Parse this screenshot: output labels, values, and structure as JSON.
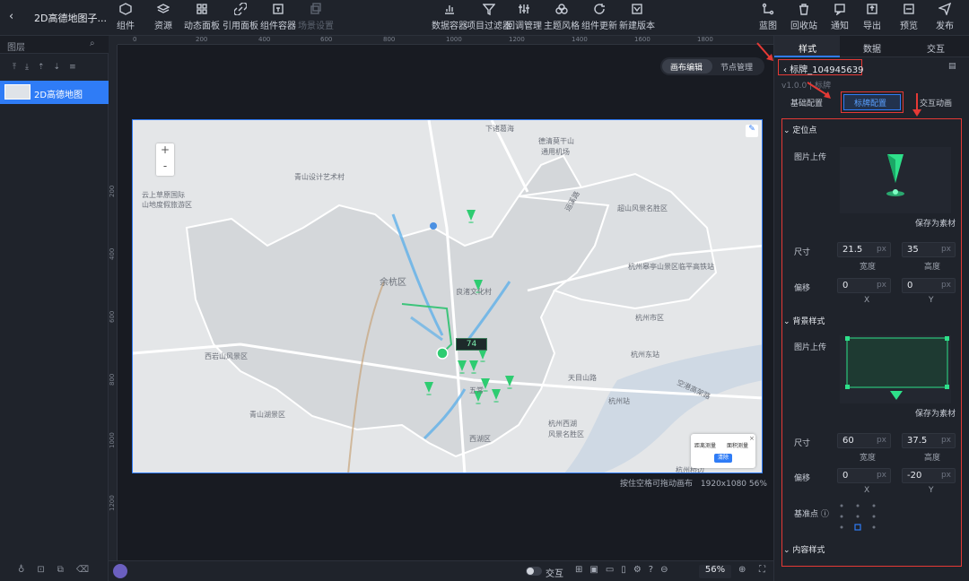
{
  "title": "2D高德地图子...",
  "toolbar": {
    "left": [
      {
        "label": "组件",
        "icon": "component-icon"
      },
      {
        "label": "资源",
        "icon": "layers-icon"
      },
      {
        "label": "动态面板",
        "icon": "panel-icon"
      },
      {
        "label": "引用面板",
        "icon": "link-icon"
      },
      {
        "label": "组件容器",
        "icon": "container-icon"
      },
      {
        "label": "场景设置",
        "icon": "scene-icon"
      }
    ],
    "middle": [
      {
        "label": "数据容器",
        "icon": "chart-icon"
      },
      {
        "label": "项目过滤器",
        "icon": "filter-icon"
      },
      {
        "label": "回调管理",
        "icon": "callback-icon"
      },
      {
        "label": "主题风格",
        "icon": "theme-icon"
      },
      {
        "label": "组件更新",
        "icon": "refresh-icon"
      },
      {
        "label": "新建版本",
        "icon": "version-icon"
      }
    ],
    "right": [
      {
        "label": "蓝图",
        "icon": "blueprint-icon"
      },
      {
        "label": "回收站",
        "icon": "trash-icon"
      },
      {
        "label": "通知",
        "icon": "bell-icon"
      },
      {
        "label": "导出",
        "icon": "export-icon"
      },
      {
        "label": "预览",
        "icon": "preview-icon"
      },
      {
        "label": "发布",
        "icon": "send-icon"
      }
    ]
  },
  "left_panel": {
    "header": "图层",
    "layer_name": "2D高德地图"
  },
  "canvas": {
    "mode_tabs": [
      "画布编辑",
      "节点管理"
    ],
    "ruler_h": [
      "0",
      "200",
      "400",
      "600",
      "800",
      "1000",
      "1200",
      "1400",
      "1600",
      "1800"
    ],
    "ruler_v": [
      "200",
      "400",
      "600",
      "800",
      "1000",
      "1200"
    ],
    "zoom_plus": "+",
    "zoom_minus": "-",
    "marker_value": "74",
    "status": "按住空格可拖动画布",
    "size_info": "1920x1080 56%",
    "map_labels": {
      "l1": "青山设计艺术村",
      "l2": "云上草原国际",
      "l3": "山地度假旅游区",
      "l4": "余杭区",
      "l5": "良渚文化村",
      "l6": "西岩山风景区",
      "l7": "青山湖景区",
      "l8": "天目山路",
      "l9": "杭州站",
      "l10": "杭州西湖",
      "l11": "风景名胜区",
      "l12": "下诸葛海",
      "l13": "德清莫干山",
      "l14": "通用机场",
      "l15": "运溪路",
      "l16": "超山风景名胜区",
      "l17": "杭州皋亭山景区",
      "l18": "临平高铁站",
      "l19": "杭州东站",
      "l20": "空港高架路",
      "l21": "五常",
      "l22": "杭州市区",
      "l23": "西湖区",
      "l24": "杭州桥边"
    },
    "popup": {
      "a": "距离测量",
      "b": "面积测量",
      "btn": "清除"
    }
  },
  "bottom_bar": {
    "toggle_label": "交互",
    "zoom": "56%"
  },
  "right_panel": {
    "tabs": [
      "样式",
      "数据",
      "交互"
    ],
    "component_name": "标牌_104945639",
    "version": "v1.0.0 | 标牌",
    "sub_tabs": [
      "基础配置",
      "标牌配置",
      "交互动画"
    ],
    "section_anchor": "定位点",
    "img_upload": "图片上传",
    "save_asset": "保存为素材",
    "size_label": "尺寸",
    "offset_label": "偏移",
    "size1": {
      "w": "21.5",
      "h": "35"
    },
    "offset1": {
      "x": "0",
      "y": "0"
    },
    "unit": "px",
    "width_label": "宽度",
    "height_label": "高度",
    "x_label": "X",
    "y_label": "Y",
    "section_bg": "背景样式",
    "size2": {
      "w": "60",
      "h": "37.5"
    },
    "offset2": {
      "x": "0",
      "y": "-20"
    },
    "base_point": "基准点",
    "section_content": "内容样式"
  },
  "colors": {
    "accent": "#2f7cf6",
    "annotation_red": "#e53935",
    "marker_green": "#2ecc71",
    "panel_bg": "#1f232b"
  }
}
